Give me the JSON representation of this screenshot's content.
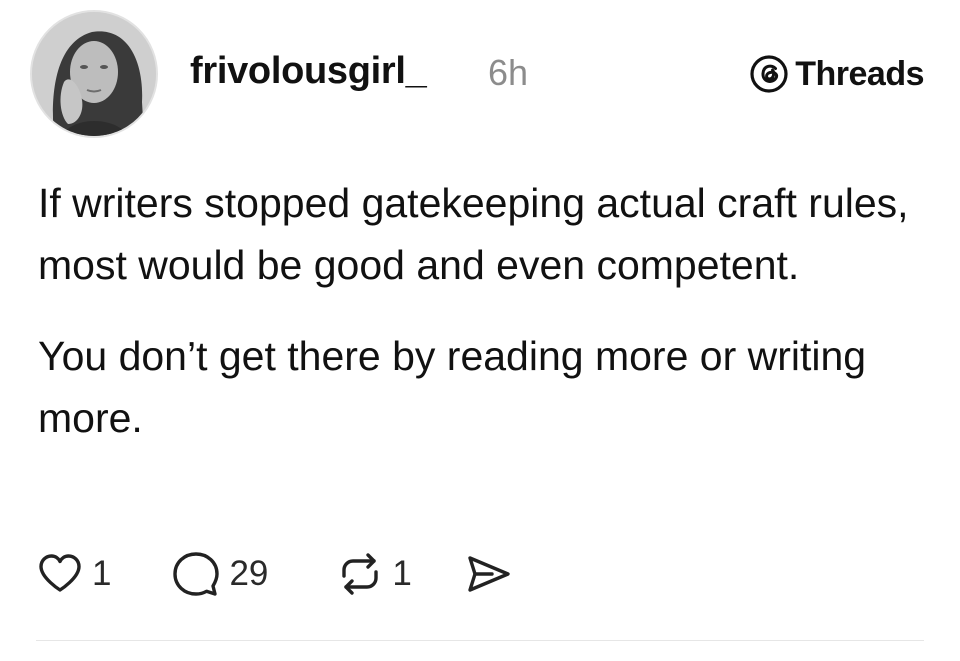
{
  "author": {
    "username": "frivolousgirl_",
    "timestamp": "6h",
    "avatar_icon": "profile-photo"
  },
  "brand": {
    "label": "Threads",
    "icon": "threads-logo-icon"
  },
  "post": {
    "paragraphs": [
      "If writers stopped gatekeeping actual craft rules, most would be good and even competent.",
      "You don’t get there by reading more or writing more."
    ]
  },
  "actions": {
    "like": {
      "icon": "heart-icon",
      "count": "1"
    },
    "reply": {
      "icon": "comment-icon",
      "count": "29"
    },
    "repost": {
      "icon": "repost-icon",
      "count": "1"
    },
    "share": {
      "icon": "send-icon"
    }
  },
  "colors": {
    "text": "#111111",
    "muted": "#8c8c8c",
    "divider": "#e6e6e6"
  }
}
